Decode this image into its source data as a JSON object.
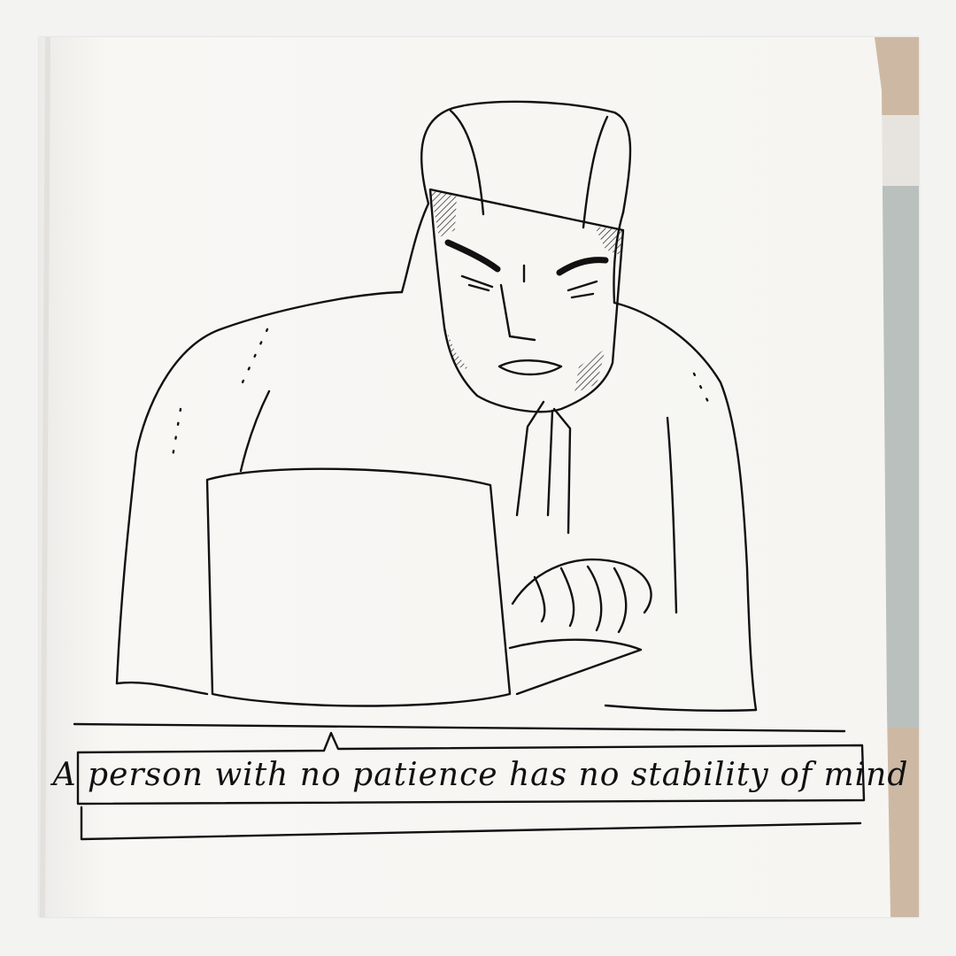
{
  "caption": "A person with no patience has no stability of mind",
  "colors": {
    "paper": "#f7f6f3",
    "ink": "#111111",
    "table_wood": "#cdb9a3",
    "notebook_edge": "#b9c0bd"
  },
  "subject": "ink-sketch-hooded-man-typing-on-laptop"
}
